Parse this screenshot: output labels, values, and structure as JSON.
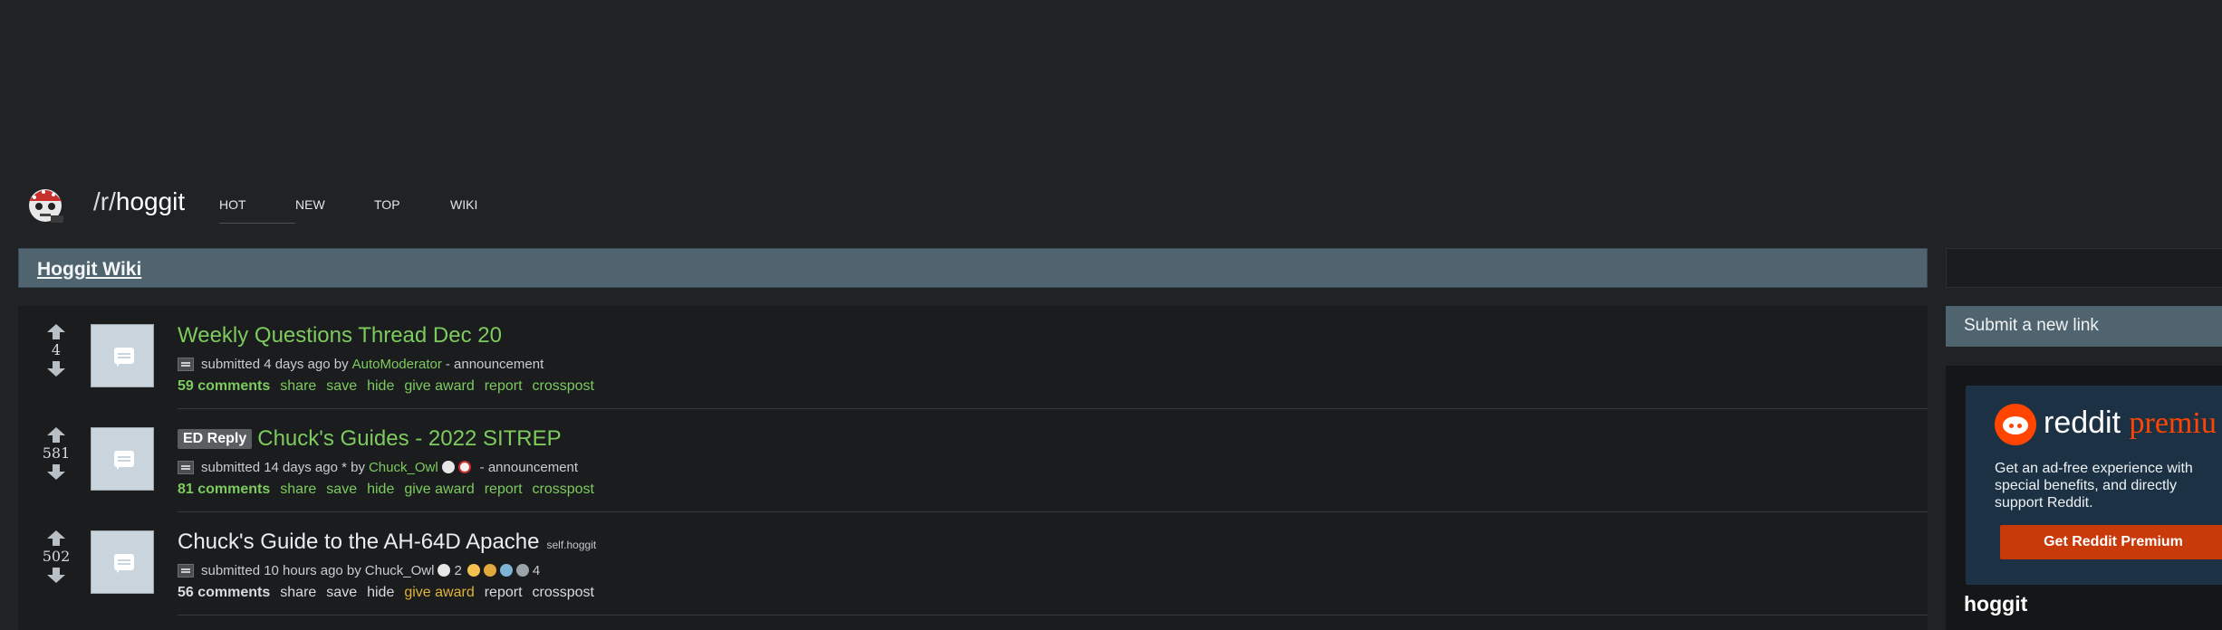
{
  "header": {
    "subreddit_prefix": "/r/",
    "subreddit_name": "hoggit",
    "tabs": [
      {
        "label": "HOT",
        "active": true
      },
      {
        "label": "NEW",
        "active": false
      },
      {
        "label": "TOP",
        "active": false
      },
      {
        "label": "WIKI",
        "active": false
      }
    ]
  },
  "wiki_bar": {
    "label": "Hoggit Wiki"
  },
  "sidebar": {
    "submit_label": "Submit a new link",
    "premium": {
      "brand": "reddit",
      "brand_suffix": "premiu",
      "description": "Get an ad-free experience with special benefits, and directly support Reddit.",
      "button_label": "Get Reddit Premium"
    },
    "title": "hoggit"
  },
  "posts": [
    {
      "score": "4",
      "flair": "",
      "title": "Weekly Questions Thread Dec 20",
      "domain": "",
      "submitted": "submitted 4 days ago by",
      "author": "AutoModerator",
      "suffix": "- announcement",
      "comments": "59 comments",
      "actions": [
        "share",
        "save",
        "hide",
        "give award",
        "report",
        "crosspost"
      ]
    },
    {
      "score": "581",
      "flair": "ED Reply",
      "title": "Chuck's Guides - 2022 SITREP",
      "domain": "",
      "submitted": "submitted 14 days ago * by",
      "author": "Chuck_Owl",
      "suffix": "- announcement",
      "comments": "81 comments",
      "actions": [
        "share",
        "save",
        "hide",
        "give award",
        "report",
        "crosspost"
      ]
    },
    {
      "score": "502",
      "flair": "",
      "title": "Chuck's Guide to the AH-64D Apache",
      "domain": "self.hoggit",
      "submitted": "submitted 10 hours ago by",
      "author": "Chuck_Owl",
      "award_count_1": "2",
      "award_count_2": "4",
      "comments": "56 comments",
      "actions": [
        "share",
        "save",
        "hide",
        "give award",
        "report",
        "crosspost"
      ]
    }
  ],
  "colors": {
    "background": "#202325",
    "accent_green": "#7dcb5e",
    "bar_blue": "#4f646f",
    "premium_orange": "#ff4500"
  }
}
